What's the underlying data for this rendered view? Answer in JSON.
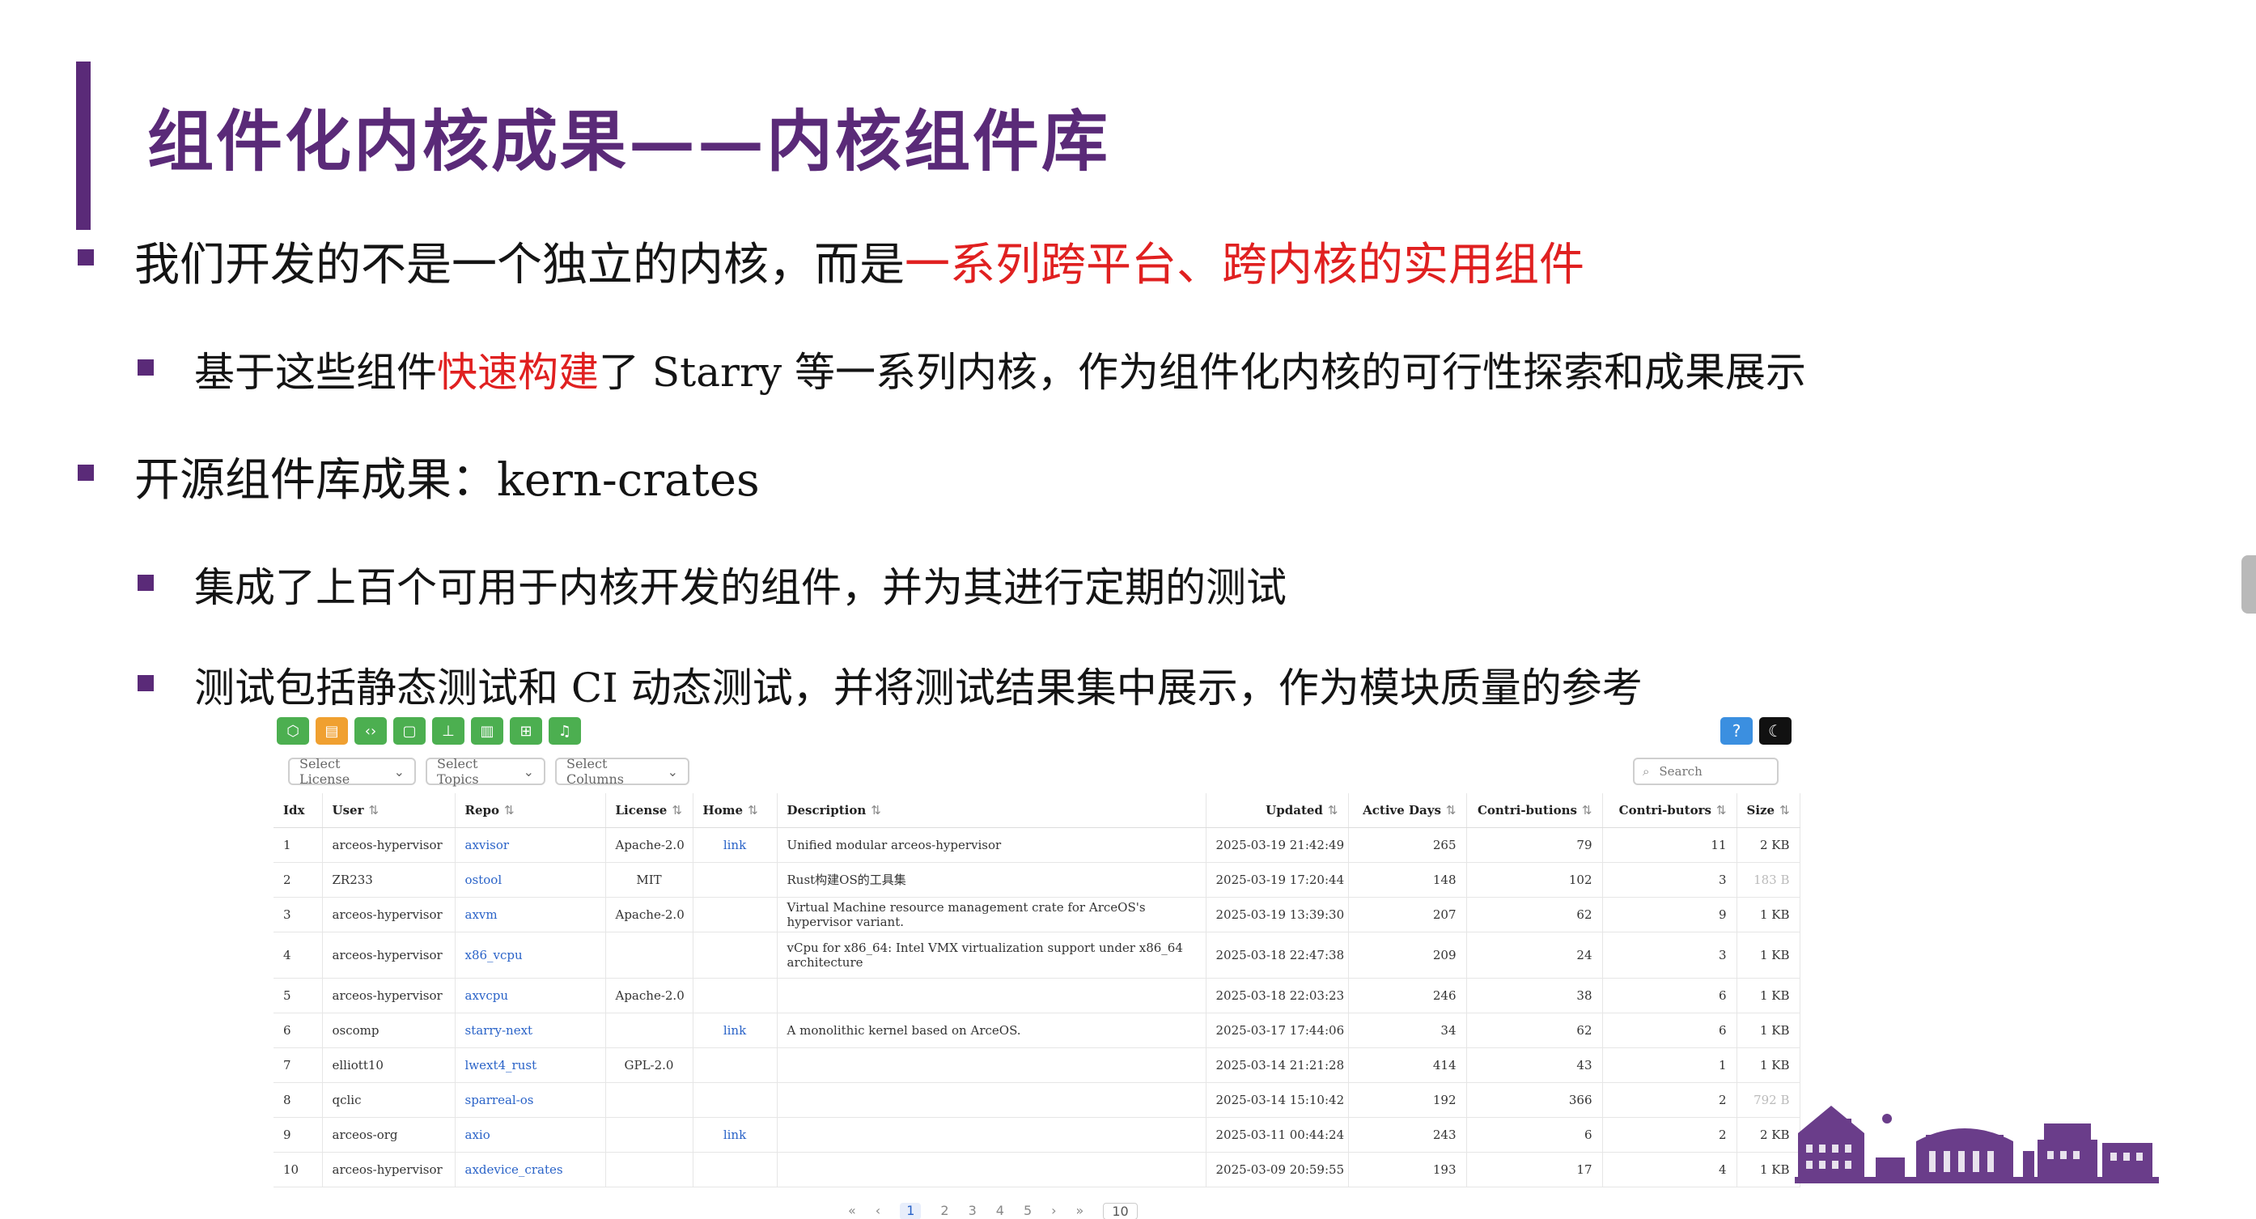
{
  "slide": {
    "title": "组件化内核成果——内核组件库",
    "bullets": [
      {
        "parts": [
          {
            "text": "我们开发的不是一个独立的内核，而是"
          },
          {
            "text": "一系列跨平台、跨内核的实用组件",
            "red": true
          }
        ]
      },
      {
        "parts": [
          {
            "text": "基于这些组件"
          },
          {
            "text": "快速构建",
            "red": true
          },
          {
            "text": "了 Starry 等一系列内核，作为组件化内核的可行性探索和成果展示"
          }
        ]
      },
      {
        "parts": [
          {
            "text": "开源组件库成果：kern-crates"
          }
        ]
      },
      {
        "parts": [
          {
            "text": "集成了上百个可用于内核开发的组件，并为其进行定期的测试"
          }
        ]
      },
      {
        "parts": [
          {
            "text": "测试包括静态测试和 CI 动态测试，并将测试结果集中展示，作为模块质量的参考"
          }
        ]
      }
    ]
  },
  "colors": {
    "accent": "#5a2a78",
    "highlight": "#e02020",
    "link": "#2a63c8"
  },
  "screenshot": {
    "toolbar_icons": [
      {
        "name": "package-icon",
        "glyph": "⬡",
        "color": "#4caf50"
      },
      {
        "name": "database-icon",
        "glyph": "▤",
        "color": "#f0a030"
      },
      {
        "name": "code-icon",
        "glyph": "‹›",
        "color": "#4caf50"
      },
      {
        "name": "square-icon",
        "glyph": "▢",
        "color": "#4caf50"
      },
      {
        "name": "org-chart-icon",
        "glyph": "⊥",
        "color": "#4caf50"
      },
      {
        "name": "bar-chart-icon",
        "glyph": "▥",
        "color": "#4caf50"
      },
      {
        "name": "grid-icon",
        "glyph": "⊞",
        "color": "#4caf50"
      },
      {
        "name": "bell-icon",
        "glyph": "♫",
        "color": "#4caf50"
      }
    ],
    "help_button": {
      "glyph": "?",
      "color": "#3b8fe0"
    },
    "theme_button": {
      "glyph": "☾",
      "color": "#111111"
    },
    "filters": {
      "license": "Select License",
      "topics": "Select Topics",
      "columns": "Select Columns"
    },
    "search_placeholder": "Search",
    "columns": [
      "Idx",
      "User",
      "Repo",
      "License",
      "Home",
      "Description",
      "Updated",
      "Active Days",
      "Contri-butions",
      "Contri-butors",
      "Size"
    ],
    "rows": [
      {
        "idx": "1",
        "user": "arceos-hypervisor",
        "repo": "axvisor",
        "license": "Apache-2.0",
        "home": "link",
        "desc": "Unified modular arceos-hypervisor",
        "updated": "2025-03-19 21:42:49",
        "active_days": "265",
        "contributions": "79",
        "contributors": "11",
        "size": "2 KB"
      },
      {
        "idx": "2",
        "user": "ZR233",
        "repo": "ostool",
        "license": "MIT",
        "home": "",
        "desc": "Rust构建OS的工具集",
        "updated": "2025-03-19 17:20:44",
        "active_days": "148",
        "contributions": "102",
        "contributors": "3",
        "size": "183 B",
        "faded_size": true
      },
      {
        "idx": "3",
        "user": "arceos-hypervisor",
        "repo": "axvm",
        "license": "Apache-2.0",
        "home": "",
        "desc": "Virtual Machine resource management crate for ArceOS's hypervisor variant.",
        "updated": "2025-03-19 13:39:30",
        "active_days": "207",
        "contributions": "62",
        "contributors": "9",
        "size": "1 KB"
      },
      {
        "idx": "4",
        "user": "arceos-hypervisor",
        "repo": "x86_vcpu",
        "license": "",
        "home": "",
        "desc": "vCpu for x86_64: Intel VMX virtualization support under x86_64 architecture",
        "updated": "2025-03-18 22:47:38",
        "active_days": "209",
        "contributions": "24",
        "contributors": "3",
        "size": "1 KB",
        "tall": true
      },
      {
        "idx": "5",
        "user": "arceos-hypervisor",
        "repo": "axvcpu",
        "license": "Apache-2.0",
        "home": "",
        "desc": "",
        "updated": "2025-03-18 22:03:23",
        "active_days": "246",
        "contributions": "38",
        "contributors": "6",
        "size": "1 KB"
      },
      {
        "idx": "6",
        "user": "oscomp",
        "repo": "starry-next",
        "license": "",
        "home": "link",
        "desc": "A monolithic kernel based on ArceOS.",
        "updated": "2025-03-17 17:44:06",
        "active_days": "34",
        "contributions": "62",
        "contributors": "6",
        "size": "1 KB"
      },
      {
        "idx": "7",
        "user": "elliott10",
        "repo": "lwext4_rust",
        "license": "GPL-2.0",
        "home": "",
        "desc": "",
        "updated": "2025-03-14 21:21:28",
        "active_days": "414",
        "contributions": "43",
        "contributors": "1",
        "size": "1 KB"
      },
      {
        "idx": "8",
        "user": "qclic",
        "repo": "sparreal-os",
        "license": "",
        "home": "",
        "desc": "",
        "updated": "2025-03-14 15:10:42",
        "active_days": "192",
        "contributions": "366",
        "contributors": "2",
        "size": "792 B",
        "faded_size": true
      },
      {
        "idx": "9",
        "user": "arceos-org",
        "repo": "axio",
        "license": "",
        "home": "link",
        "desc": "",
        "updated": "2025-03-11 00:44:24",
        "active_days": "243",
        "contributions": "6",
        "contributors": "2",
        "size": "2 KB"
      },
      {
        "idx": "10",
        "user": "arceos-hypervisor",
        "repo": "axdevice_crates",
        "license": "",
        "home": "",
        "desc": "",
        "updated": "2025-03-09 20:59:55",
        "active_days": "193",
        "contributions": "17",
        "contributors": "4",
        "size": "1 KB"
      }
    ],
    "pagination": {
      "first": "«",
      "prev": "‹",
      "pages": [
        "1",
        "2",
        "3",
        "4",
        "5"
      ],
      "current": "1",
      "next": "›",
      "last": "»",
      "page_size": "10"
    }
  }
}
